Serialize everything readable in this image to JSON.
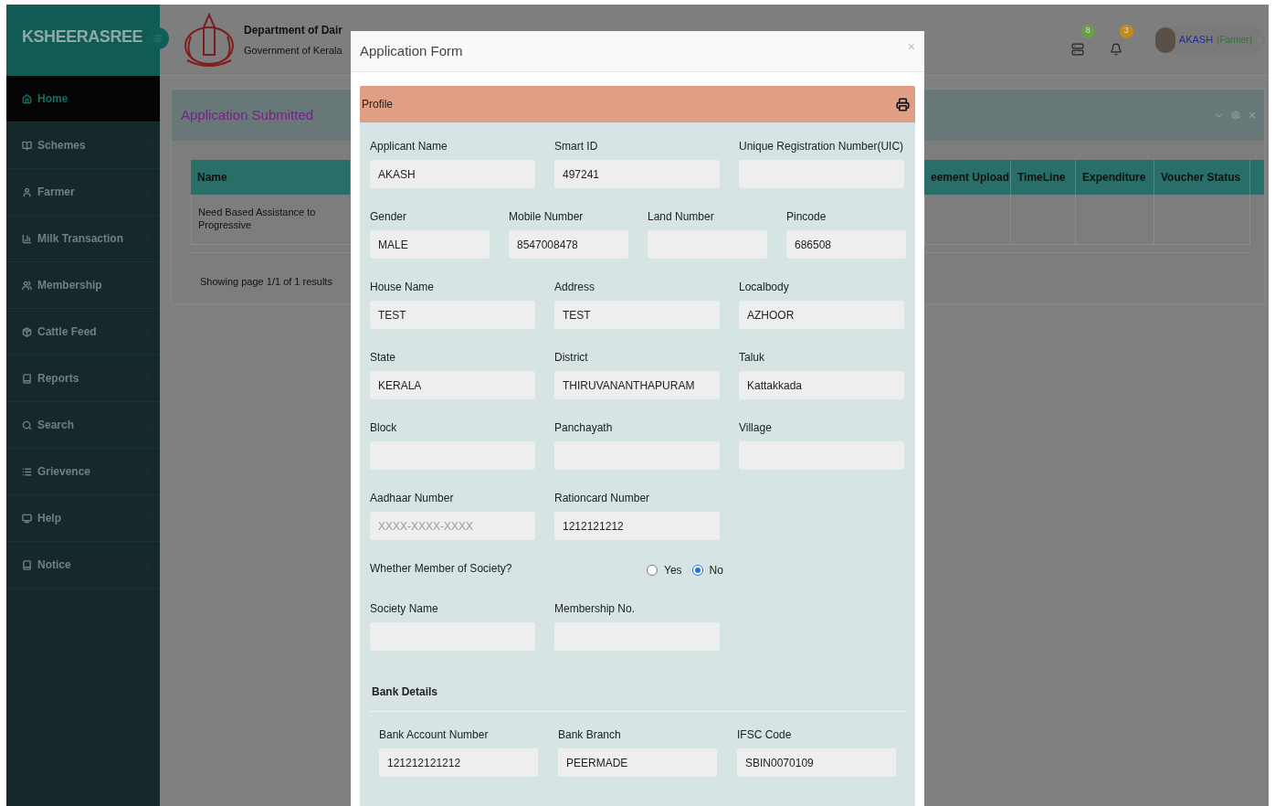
{
  "sidebar": {
    "brand": "KSHEERASREE",
    "items": [
      {
        "label": "Home",
        "selected": true
      },
      {
        "label": "Schemes",
        "selected": false
      },
      {
        "label": "Farmer",
        "selected": false
      },
      {
        "label": "Milk Transaction",
        "selected": false
      },
      {
        "label": "Membership",
        "selected": false
      },
      {
        "label": "Cattle Feed",
        "selected": false
      },
      {
        "label": "Reports",
        "selected": false
      },
      {
        "label": "Search",
        "selected": false
      },
      {
        "label": "Grievence",
        "selected": false
      },
      {
        "label": "Help",
        "selected": false
      },
      {
        "label": "Notice",
        "selected": false
      }
    ]
  },
  "header": {
    "department": "Department of Dair",
    "government": "Government of Kerala",
    "badges": [
      {
        "count": "8",
        "color": "#6a9f4a"
      },
      {
        "count": "3",
        "color": "#c38a1c"
      }
    ],
    "user": {
      "name": "AKASH",
      "role": "(Farmer)"
    }
  },
  "panel": {
    "title": "Application Submitted",
    "table": {
      "columns": [
        "Name",
        "eement Upload",
        "TimeLine",
        "Expenditure",
        "Voucher Status"
      ],
      "rows": [
        {
          "name": "Need Based Assistance to Progressive"
        }
      ]
    },
    "pager": "Showing page 1/1 of 1 results"
  },
  "modal": {
    "title": "Application Form",
    "close": "×",
    "section": "Profile",
    "rows": [
      [
        {
          "label": "Applicant Name",
          "value": "AKASH"
        },
        {
          "label": "Smart ID",
          "value": "497241"
        },
        {
          "label": "Unique Registration Number(UIC)"
        }
      ],
      [
        {
          "label": "Gender",
          "value": "MALE"
        },
        {
          "label": "Mobile Number",
          "value": "8547008478"
        },
        {
          "label": "Land Number"
        },
        {
          "label": "Pincode",
          "value": "686508"
        }
      ],
      [
        {
          "label": "House Name",
          "value": "TEST"
        },
        {
          "label": "Address",
          "value": "TEST"
        },
        {
          "label": "Localbody",
          "value": "AZHOOR"
        }
      ],
      [
        {
          "label": "State",
          "value": "KERALA"
        },
        {
          "label": "District",
          "value": "THIRUVANANTHAPURAM"
        },
        {
          "label": "Taluk",
          "value": "Kattakkada"
        }
      ],
      [
        {
          "label": "Block"
        },
        {
          "label": "Panchayath"
        },
        {
          "label": "Village"
        }
      ],
      [
        {
          "label": "Aadhaar Number",
          "placeholder": "XXXX-XXXX-XXXX"
        },
        {
          "label": "Rationcard Number",
          "value": "1212121212"
        }
      ]
    ],
    "question": {
      "label": "Whether Member of Society?",
      "options": [
        {
          "label": "Yes",
          "selected": false
        },
        {
          "label": "No",
          "selected": true
        }
      ]
    },
    "society": [
      {
        "label": "Society Name"
      },
      {
        "label": "Membership No."
      }
    ],
    "bank": {
      "title": "Bank Details",
      "fields": [
        {
          "label": "Bank Account Number",
          "value": "121212121212"
        },
        {
          "label": "Bank Branch",
          "value": "PEERMADE"
        },
        {
          "label": "IFSC Code",
          "value": "SBIN0070109"
        }
      ]
    }
  }
}
